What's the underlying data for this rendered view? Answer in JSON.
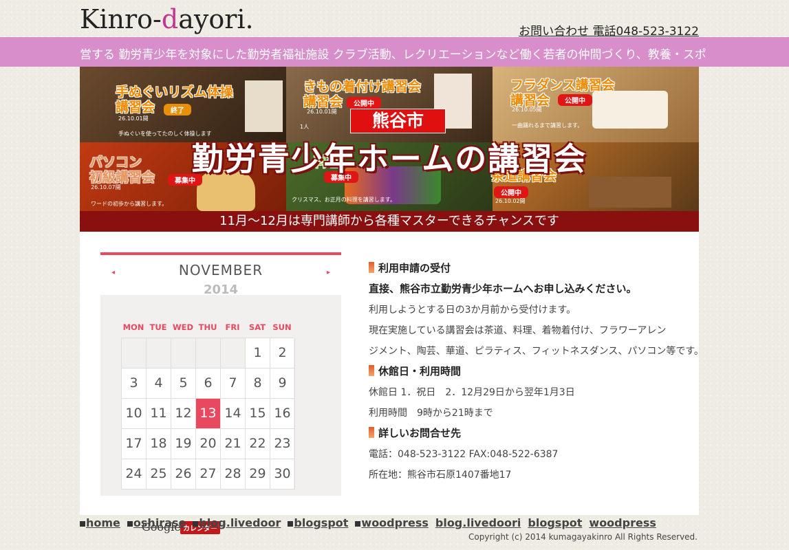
{
  "header": {
    "logo_part1": "Kinro-",
    "logo_part2": "d",
    "logo_part3": "ayori.",
    "contact": "お問い合わせ 電話048-523-3122"
  },
  "marquee": "営する 勤労青少年を対象にした勤労者福祉施設 クラブ活動、レクリエーションなど働く若者の仲間づくり、教養・スポ",
  "banner": {
    "panels": [
      {
        "title_line1": "手ぬぐいリズム体操",
        "title_line2": "講習会",
        "tag": "終了",
        "date": "26.10.01開",
        "note": "手ぬぐいを使ってたのしく体操します"
      },
      {
        "title_line1": "きもの着付け講習会",
        "title_line2": "講習会",
        "tag": "公開中",
        "date": "26.10.01開",
        "note": "1人"
      },
      {
        "title_line1": "フラダンス講習会",
        "title_line2": "講習会",
        "tag": "公開中",
        "date": "26.10.05開",
        "note": "一曲踊れるまで講習します。"
      },
      {
        "title_line1": "パソコン",
        "title_line2": "初級講習会",
        "tag": "募集中",
        "date": "26.10.07開",
        "note": "ワードの初歩から講習します。"
      },
      {
        "title_line1": "料理",
        "title_line2": "",
        "tag": "募集中",
        "date": "",
        "note": "クリスマス、お正月の料理を講習します。"
      },
      {
        "title_line1": "茶道講習会",
        "title_line2": "",
        "tag": "公開中",
        "date": "26.10.02開",
        "note": ""
      }
    ],
    "city": "熊谷市",
    "title": "勤労青少年ホームの講習会",
    "subtitle": "11月～12月は専門講師から各種マスターできるチャンスです"
  },
  "calendar": {
    "month": "NOVEMBER",
    "year": "2014",
    "prev_label": "◂",
    "next_label": "▸",
    "weekdays": [
      "MON",
      "TUE",
      "WED",
      "THU",
      "FRI",
      "SAT",
      "SUN"
    ],
    "weeks": [
      [
        "",
        "",
        "",
        "",
        "",
        "1",
        "2"
      ],
      [
        "3",
        "4",
        "5",
        "6",
        "7",
        "8",
        "9"
      ],
      [
        "10",
        "11",
        "12",
        "13",
        "14",
        "15",
        "16"
      ],
      [
        "17",
        "18",
        "19",
        "20",
        "21",
        "22",
        "23"
      ],
      [
        "24",
        "25",
        "26",
        "27",
        "28",
        "29",
        "30"
      ]
    ],
    "today": "13",
    "google_label": "Google",
    "calendar_label": "カレンダー"
  },
  "info": {
    "h1": "利用申請の受付",
    "p1": "直接、熊谷市立勤労青少年ホームへお申し込みください。",
    "p2": "利用しようとする日の3か月前から受付けます。",
    "p3": "現在実施している講習会は茶道、料理、着物着付け、フラワーアレン",
    "p4": "ジメント、陶芸、華道、ピラティス、フィットネスダンス、パソコン等です。",
    "h2": "休館日・利用時間",
    "p5": "休館日 1．祝日　2．12月29日から翌年1月3日",
    "p6": "利用時間　9時から21時まで",
    "h3": "詳しいお問合せ先",
    "p7": "電話：048-523-3122 FAX:048-522-6387",
    "p8": "所在地：熊谷市石原1407番地17"
  },
  "nav": [
    {
      "label": "home",
      "square": true
    },
    {
      "label": "oshirase",
      "square": true
    },
    {
      "label": "blog.livedoor",
      "square": true
    },
    {
      "label": "blogspot",
      "square": true
    },
    {
      "label": "woodpress",
      "square": true
    },
    {
      "label": "blog.livedoori",
      "square": false
    },
    {
      "label": "blogspot",
      "square": false
    },
    {
      "label": "woodpress",
      "square": false
    }
  ],
  "copyright": "Copyright (c) 2014 kumagayakinro All Rights Reserved.",
  "colors": {
    "accent": "#e8495e",
    "marquee_bg": "#d98ecc",
    "logo_accent": "#c8338f"
  }
}
